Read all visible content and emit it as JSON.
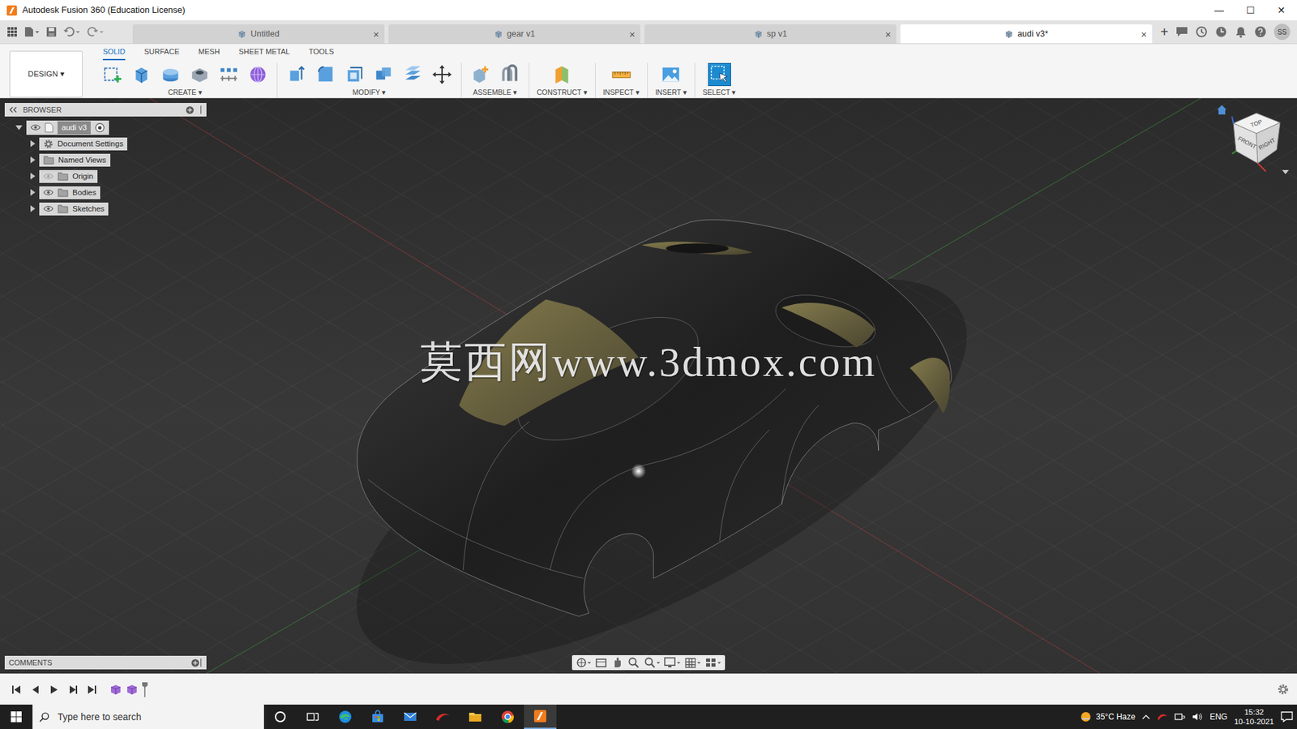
{
  "window": {
    "title": "Autodesk Fusion 360 (Education License)",
    "controls": [
      "—",
      "☐",
      "✕"
    ]
  },
  "doc_tabs": [
    {
      "label": "Untitled",
      "selected": false,
      "close": "×"
    },
    {
      "label": "gear v1",
      "selected": false,
      "close": "×"
    },
    {
      "label": "sp v1",
      "selected": false,
      "close": "×"
    },
    {
      "label": "audi v3*",
      "selected": true,
      "close": "×"
    }
  ],
  "new_tab": "+",
  "user": {
    "initials": "SS"
  },
  "workspace": {
    "label": "DESIGN ▾"
  },
  "toolbar_tabs": [
    {
      "label": "SOLID",
      "selected": true
    },
    {
      "label": "SURFACE",
      "selected": false
    },
    {
      "label": "MESH",
      "selected": false
    },
    {
      "label": "SHEET METAL",
      "selected": false
    },
    {
      "label": "TOOLS",
      "selected": false
    }
  ],
  "tool_groups": [
    {
      "label": "CREATE ▾",
      "active": false
    },
    {
      "label": "MODIFY ▾",
      "active": false
    },
    {
      "label": "ASSEMBLE ▾",
      "active": false
    },
    {
      "label": "CONSTRUCT ▾",
      "active": false
    },
    {
      "label": "INSPECT ▾",
      "active": false
    },
    {
      "label": "INSERT ▾",
      "active": false
    },
    {
      "label": "SELECT ▾",
      "active": true
    }
  ],
  "browser": {
    "title": "BROWSER",
    "root": {
      "label": "audi v3",
      "expanded": true,
      "visible": true
    },
    "items": [
      {
        "label": "Document Settings",
        "kind": "settings",
        "expanded": false
      },
      {
        "label": "Named Views",
        "kind": "views",
        "expanded": false
      },
      {
        "label": "Origin",
        "kind": "folder",
        "expanded": false,
        "visible": false
      },
      {
        "label": "Bodies",
        "kind": "folder",
        "expanded": false,
        "visible": true
      },
      {
        "label": "Sketches",
        "kind": "folder",
        "expanded": false,
        "visible": true
      }
    ]
  },
  "viewcube": {
    "top": "TOP",
    "front": "FRONT",
    "right": "RIGHT"
  },
  "watermark": "莫西网www.3dmox.com",
  "comments": {
    "title": "COMMENTS"
  },
  "taskbar": {
    "search_placeholder": "Type here to search",
    "weather": "35°C Haze",
    "language": "ENG",
    "time": "15:32",
    "date": "10-10-2021"
  }
}
